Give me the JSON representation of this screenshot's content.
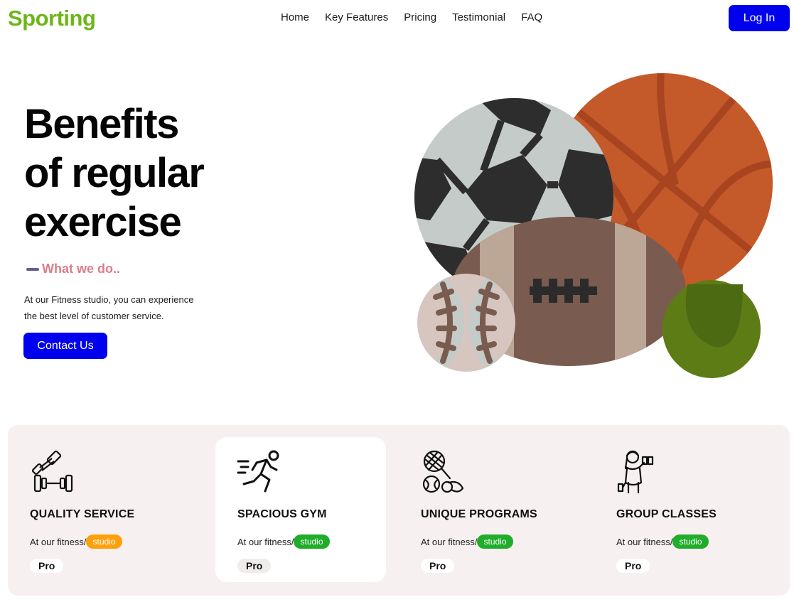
{
  "header": {
    "brand": "Sporting",
    "nav": [
      "Home",
      "Key Features",
      "Pricing",
      "Testimonial",
      "FAQ"
    ],
    "login_label": "Log In"
  },
  "hero": {
    "title_lines": [
      "Benefits",
      "of regular",
      "exercise"
    ],
    "tagline": "What we do..",
    "description": "At our Fitness studio, you can experience the best level of customer service.",
    "contact_label": "Contact Us"
  },
  "features": [
    {
      "title": "QUALITY SERVICE",
      "text": "At our fitness/",
      "badge": "studio",
      "badge_color": "#ff9f0a",
      "plan": "Pro",
      "icon": "dumbbell-icon",
      "active": false
    },
    {
      "title": "SPACIOUS GYM",
      "text": "At our fitness/",
      "badge": "studio",
      "badge_color": "#1fad2a",
      "plan": "Pro",
      "icon": "runner-icon",
      "active": true
    },
    {
      "title": "UNIQUE PROGRAMS",
      "text": "At our fitness/",
      "badge": "studio",
      "badge_color": "#1fad2a",
      "plan": "Pro",
      "icon": "sports-equipment-icon",
      "active": false
    },
    {
      "title": "GROUP CLASSES",
      "text": "At our fitness/",
      "badge": "studio",
      "badge_color": "#1fad2a",
      "plan": "Pro",
      "icon": "woman-lifting-icon",
      "active": false
    }
  ],
  "colors": {
    "brand": "#6cb617",
    "primary_button": "#0000ee",
    "tagline": "#d97f8a",
    "features_bg": "#f6f1f0"
  }
}
